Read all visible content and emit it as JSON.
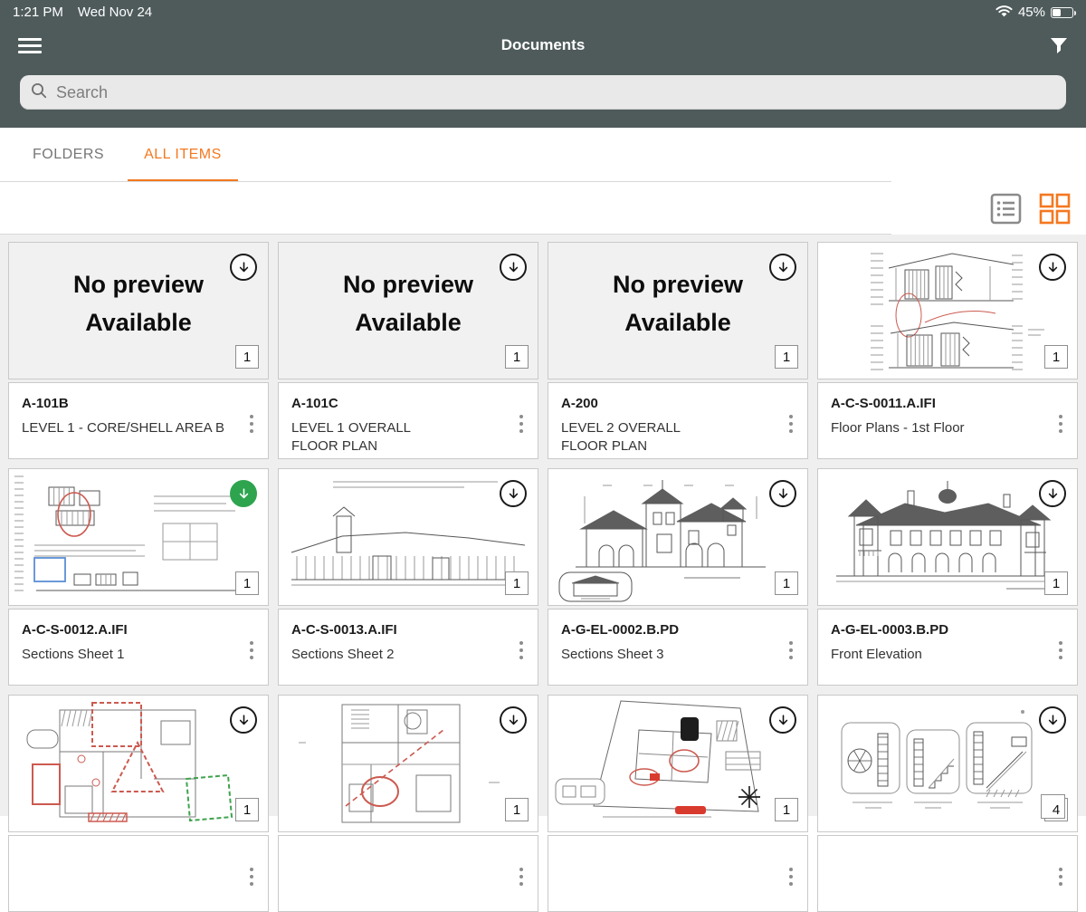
{
  "status_bar": {
    "time": "1:21 PM",
    "date": "Wed Nov 24",
    "wifi_icon": "wifi-icon",
    "battery_percent": "45%",
    "battery_level": 0.45
  },
  "nav": {
    "title": "Documents",
    "menu_icon": "hamburger-menu-icon",
    "filter_icon": "filter-funnel-icon"
  },
  "search": {
    "placeholder": "Search",
    "icon": "search-icon"
  },
  "tabs": [
    {
      "label": "FOLDERS",
      "active": false
    },
    {
      "label": "ALL ITEMS",
      "active": true
    }
  ],
  "view_controls": {
    "list_icon": "list-view-icon",
    "grid_icon": "grid-view-icon",
    "active_view": "grid"
  },
  "colors": {
    "accent": "#F4781F",
    "header_bg": "#4F5B5B",
    "downloaded_green": "#2EA44F",
    "content_bg": "#EFEFEF",
    "card_border": "#C9C9C9"
  },
  "no_preview_label": "No preview Available",
  "cards": [
    {
      "sheet_number": "A-101B",
      "sheet_name": "LEVEL 1 - CORE/SHELL AREA B",
      "page_count": "1",
      "download_state": "available",
      "preview": "none"
    },
    {
      "sheet_number": "A-101C",
      "sheet_name": "LEVEL 1 OVERALL\nFLOOR PLAN",
      "page_count": "1",
      "download_state": "available",
      "preview": "none"
    },
    {
      "sheet_number": "A-200",
      "sheet_name": "LEVEL 2 OVERALL\nFLOOR PLAN",
      "page_count": "1",
      "download_state": "available",
      "preview": "none"
    },
    {
      "sheet_number": "A-C-S-0011.A.IFI",
      "sheet_name": "Floor Plans - 1st Floor",
      "page_count": "1",
      "download_state": "available",
      "preview": "sections-stacked"
    },
    {
      "sheet_number": "A-C-S-0012.A.IFI",
      "sheet_name": "Sections Sheet 1",
      "page_count": "1",
      "download_state": "downloaded",
      "preview": "sections-markup"
    },
    {
      "sheet_number": "A-C-S-0013.A.IFI",
      "sheet_name": "Sections Sheet 2",
      "page_count": "1",
      "download_state": "available",
      "preview": "long-section"
    },
    {
      "sheet_number": "A-G-EL-0002.B.PD",
      "sheet_name": "Sections Sheet 3",
      "page_count": "1",
      "download_state": "available",
      "preview": "front-elevation"
    },
    {
      "sheet_number": "A-G-EL-0003.B.PD",
      "sheet_name": "Front Elevation",
      "page_count": "1",
      "download_state": "available",
      "preview": "rear-elevation"
    },
    {
      "sheet_number": "",
      "sheet_name": "",
      "page_count": "1",
      "download_state": "available",
      "preview": "floorplan-markups"
    },
    {
      "sheet_number": "",
      "sheet_name": "",
      "page_count": "1",
      "download_state": "available",
      "preview": "floorplan-circle"
    },
    {
      "sheet_number": "",
      "sheet_name": "",
      "page_count": "1",
      "download_state": "available",
      "preview": "siteplan"
    },
    {
      "sheet_number": "",
      "sheet_name": "",
      "page_count": "4",
      "download_state": "available",
      "preview": "details",
      "stacked_badge": true
    }
  ]
}
